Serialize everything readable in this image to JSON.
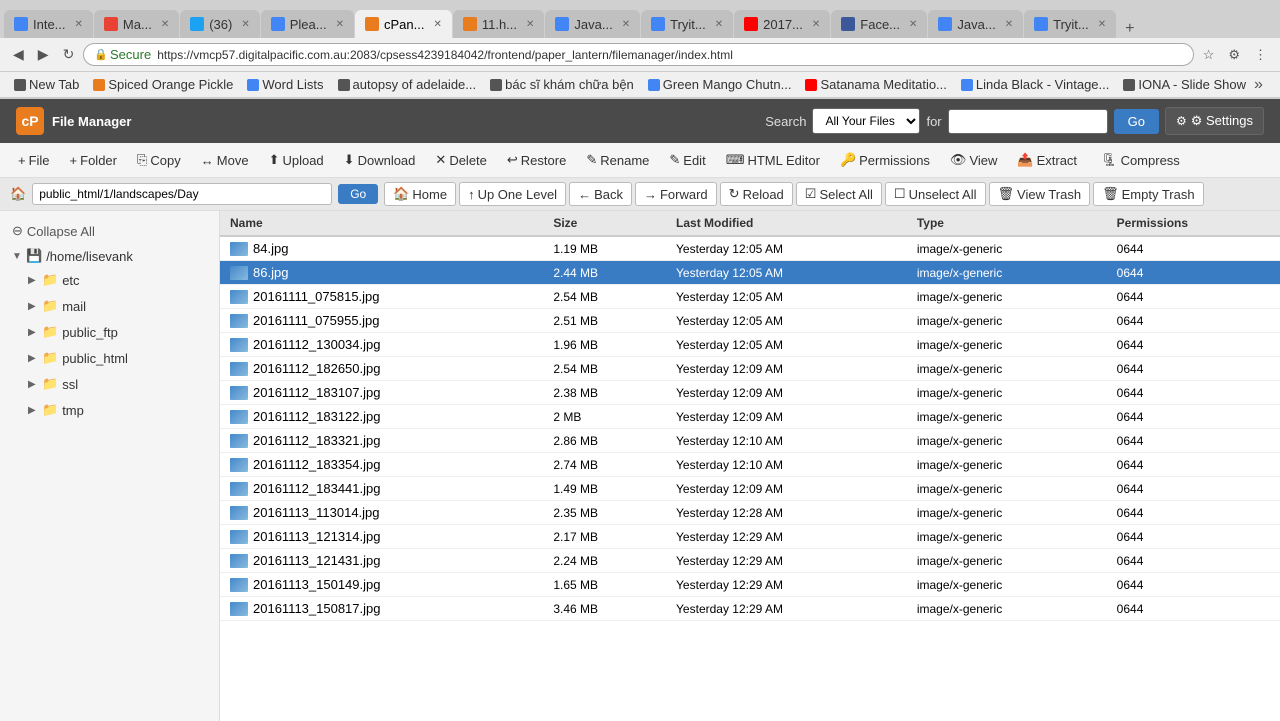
{
  "browser": {
    "tabs": [
      {
        "id": 1,
        "label": "Inte...",
        "color": "#4285f4",
        "active": false
      },
      {
        "id": 2,
        "label": "Ma...",
        "color": "#ea4335",
        "active": false
      },
      {
        "id": 3,
        "label": "(36)",
        "color": "#1da1f2",
        "active": false
      },
      {
        "id": 4,
        "label": "Plea...",
        "color": "#4285f4",
        "active": false
      },
      {
        "id": 5,
        "label": "cPan...",
        "color": "#e87c1e",
        "active": true
      },
      {
        "id": 6,
        "label": "11.h...",
        "color": "#e87c1e",
        "active": false
      },
      {
        "id": 7,
        "label": "Java...",
        "color": "#4285f4",
        "active": false
      },
      {
        "id": 8,
        "label": "Tryit...",
        "color": "#4285f4",
        "active": false
      },
      {
        "id": 9,
        "label": "2017...",
        "color": "#ff0000",
        "active": false
      },
      {
        "id": 10,
        "label": "Face...",
        "color": "#3b5998",
        "active": false
      },
      {
        "id": 11,
        "label": "Java...",
        "color": "#4285f4",
        "active": false
      },
      {
        "id": 12,
        "label": "Tryit...",
        "color": "#4285f4",
        "active": false
      }
    ],
    "url": "https://vmcp57.digitalpacific.com.au:2083/cpsess4239184042/frontend/paper_lantern/filemanager/index.html",
    "secure_label": "Secure",
    "bookmarks": [
      {
        "label": "New Tab",
        "icon": ""
      },
      {
        "label": "Spiced Orange Pickle",
        "color": "#e87c1e"
      },
      {
        "label": "Word Lists",
        "color": "#4285f4"
      },
      {
        "label": "autopsy of adelaide...",
        "color": "#555"
      },
      {
        "label": "bác sĩ khám chữa bện",
        "color": "#555"
      },
      {
        "label": "Green Mango Chutn...",
        "color": "#4285f4"
      },
      {
        "label": "Satanama Meditatio...",
        "color": "#ff0000"
      },
      {
        "label": "Linda Black - Vintage...",
        "color": "#4285f4"
      },
      {
        "label": "IONA - Slide Show",
        "color": "#555"
      }
    ]
  },
  "app": {
    "title": "File Manager",
    "logo_text": "cP",
    "search": {
      "label": "Search",
      "select_default": "All Your Files",
      "for_label": "for",
      "input_placeholder": "",
      "go_label": "Go"
    },
    "settings_label": "⚙ Settings"
  },
  "toolbar": {
    "buttons": [
      {
        "id": "file",
        "icon": "+",
        "label": "File"
      },
      {
        "id": "folder",
        "icon": "+",
        "label": "Folder"
      },
      {
        "id": "copy",
        "icon": "",
        "label": "Copy"
      },
      {
        "id": "move",
        "icon": "",
        "label": "Move"
      },
      {
        "id": "upload",
        "icon": "",
        "label": "Upload"
      },
      {
        "id": "download",
        "icon": "",
        "label": "Download"
      },
      {
        "id": "delete",
        "icon": "✕",
        "label": "Delete"
      },
      {
        "id": "restore",
        "icon": "",
        "label": "Restore"
      },
      {
        "id": "rename",
        "icon": "",
        "label": "Rename"
      },
      {
        "id": "edit",
        "icon": "",
        "label": "Edit"
      },
      {
        "id": "html_editor",
        "icon": "",
        "label": "HTML Editor"
      },
      {
        "id": "permissions",
        "icon": "",
        "label": "Permissions"
      },
      {
        "id": "view",
        "icon": "",
        "label": "View"
      },
      {
        "id": "extract",
        "icon": "",
        "label": "Extract"
      },
      {
        "id": "compress",
        "icon": "",
        "label": "Compress"
      }
    ]
  },
  "path_bar": {
    "current_path": "public_html/1/landscapes/Day",
    "go_label": "Go",
    "home_label": "Home",
    "up_one_label": "Up One Level",
    "back_label": "Back",
    "forward_label": "Forward",
    "reload_label": "Reload",
    "select_all_label": "Select All",
    "unselect_all_label": "Unselect All",
    "view_trash_label": "View Trash",
    "empty_trash_label": "Empty Trash"
  },
  "sidebar": {
    "collapse_label": "Collapse All",
    "tree": [
      {
        "id": "root",
        "label": "/home/lisevank",
        "icon": "🏠",
        "expanded": true,
        "children": [
          {
            "id": "etc",
            "label": "etc",
            "icon": "📁",
            "expanded": false,
            "children": []
          },
          {
            "id": "mail",
            "label": "mail",
            "icon": "📁",
            "expanded": false,
            "children": []
          },
          {
            "id": "public_ftp",
            "label": "public_ftp",
            "icon": "📁",
            "expanded": false,
            "children": []
          },
          {
            "id": "public_html",
            "label": "public_html",
            "icon": "📁",
            "expanded": false,
            "children": []
          },
          {
            "id": "ssl",
            "label": "ssl",
            "icon": "📁",
            "expanded": false,
            "children": []
          },
          {
            "id": "tmp",
            "label": "tmp",
            "icon": "📁",
            "expanded": false,
            "children": []
          }
        ]
      }
    ]
  },
  "file_list": {
    "columns": [
      {
        "id": "name",
        "label": "Name"
      },
      {
        "id": "size",
        "label": "Size"
      },
      {
        "id": "last_modified",
        "label": "Last Modified"
      },
      {
        "id": "type",
        "label": "Type"
      },
      {
        "id": "permissions",
        "label": "Permissions"
      }
    ],
    "files": [
      {
        "name": "84.jpg",
        "size": "1.19 MB",
        "modified": "Yesterday 12:05 AM",
        "type": "image/x-generic",
        "perms": "0644",
        "selected": false
      },
      {
        "name": "86.jpg",
        "size": "2.44 MB",
        "modified": "Yesterday 12:05 AM",
        "type": "image/x-generic",
        "perms": "0644",
        "selected": true
      },
      {
        "name": "20161111_075815.jpg",
        "size": "2.54 MB",
        "modified": "Yesterday 12:05 AM",
        "type": "image/x-generic",
        "perms": "0644",
        "selected": false
      },
      {
        "name": "20161111_075955.jpg",
        "size": "2.51 MB",
        "modified": "Yesterday 12:05 AM",
        "type": "image/x-generic",
        "perms": "0644",
        "selected": false
      },
      {
        "name": "20161112_130034.jpg",
        "size": "1.96 MB",
        "modified": "Yesterday 12:05 AM",
        "type": "image/x-generic",
        "perms": "0644",
        "selected": false
      },
      {
        "name": "20161112_182650.jpg",
        "size": "2.54 MB",
        "modified": "Yesterday 12:09 AM",
        "type": "image/x-generic",
        "perms": "0644",
        "selected": false
      },
      {
        "name": "20161112_183107.jpg",
        "size": "2.38 MB",
        "modified": "Yesterday 12:09 AM",
        "type": "image/x-generic",
        "perms": "0644",
        "selected": false
      },
      {
        "name": "20161112_183122.jpg",
        "size": "2 MB",
        "modified": "Yesterday 12:09 AM",
        "type": "image/x-generic",
        "perms": "0644",
        "selected": false
      },
      {
        "name": "20161112_183321.jpg",
        "size": "2.86 MB",
        "modified": "Yesterday 12:10 AM",
        "type": "image/x-generic",
        "perms": "0644",
        "selected": false
      },
      {
        "name": "20161112_183354.jpg",
        "size": "2.74 MB",
        "modified": "Yesterday 12:10 AM",
        "type": "image/x-generic",
        "perms": "0644",
        "selected": false
      },
      {
        "name": "20161112_183441.jpg",
        "size": "1.49 MB",
        "modified": "Yesterday 12:09 AM",
        "type": "image/x-generic",
        "perms": "0644",
        "selected": false
      },
      {
        "name": "20161113_113014.jpg",
        "size": "2.35 MB",
        "modified": "Yesterday 12:28 AM",
        "type": "image/x-generic",
        "perms": "0644",
        "selected": false
      },
      {
        "name": "20161113_121314.jpg",
        "size": "2.17 MB",
        "modified": "Yesterday 12:29 AM",
        "type": "image/x-generic",
        "perms": "0644",
        "selected": false
      },
      {
        "name": "20161113_121431.jpg",
        "size": "2.24 MB",
        "modified": "Yesterday 12:29 AM",
        "type": "image/x-generic",
        "perms": "0644",
        "selected": false
      },
      {
        "name": "20161113_150149.jpg",
        "size": "1.65 MB",
        "modified": "Yesterday 12:29 AM",
        "type": "image/x-generic",
        "perms": "0644",
        "selected": false
      },
      {
        "name": "20161113_150817.jpg",
        "size": "3.46 MB",
        "modified": "Yesterday 12:29 AM",
        "type": "image/x-generic",
        "perms": "0644",
        "selected": false
      }
    ]
  }
}
